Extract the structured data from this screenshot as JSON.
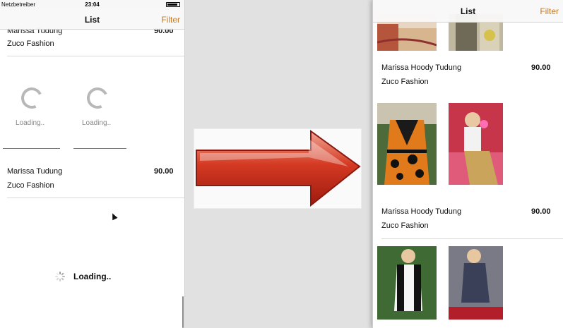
{
  "left": {
    "carrier": "Netzbetreiber",
    "time": "23:04",
    "title": "List",
    "filter": "Filter",
    "cells": [
      {
        "name": "Marissa Tudung",
        "brand": "Zuco Fashion",
        "price": "90.00"
      },
      {
        "name": "Marissa Tudung",
        "brand": "Zuco Fashion",
        "price": "90.00"
      }
    ],
    "tile_loading": "Loading..",
    "footer_loading": "Loading.."
  },
  "right": {
    "title": "List",
    "filter": "Filter",
    "cells": [
      {
        "name": "Marissa Hoody Tudung",
        "brand": "Zuco Fashion",
        "price": "90.00"
      },
      {
        "name": "Marissa Hoody Tudung",
        "brand": "Zuco Fashion",
        "price": "90.00"
      }
    ]
  },
  "colors": {
    "accent": "#c57a24",
    "arrow": "#c0281a"
  }
}
